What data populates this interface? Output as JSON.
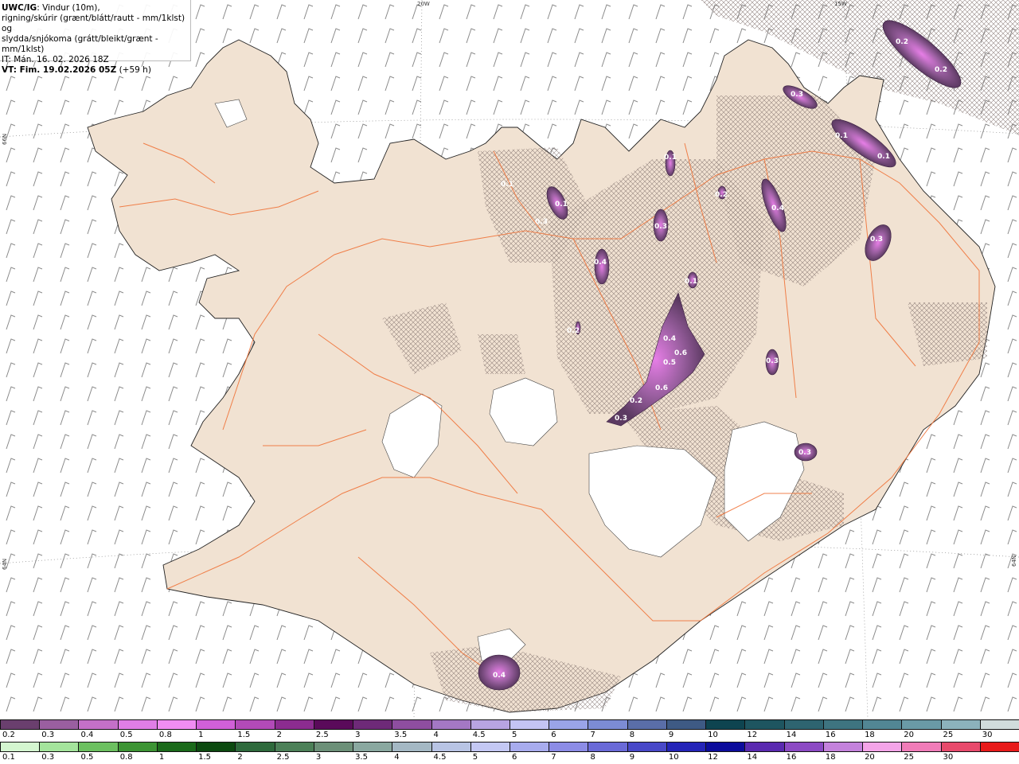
{
  "title": {
    "bold_prefix": "UWC/IG",
    "line1_rest": ": Vindur (10m),",
    "line2": "rigning/skúrir (grænt/blátt/rautt - mm/1klst) og",
    "line3": "slydda/snjókoma (grátt/bleikt/grænt - mm/1klst)",
    "line4": "IT: Mán. 16. 02. 2026 18Z",
    "line5_bold": "VT: Fim. 19.02.2026 05Z",
    "line5_rest": " (+59 h)"
  },
  "coords": {
    "lon_20w": "20W",
    "lon_15w": "15W",
    "lat_66n_left": "66N",
    "lat_64n_left": "64N",
    "lat_64n_right": "64N"
  },
  "contour_labels": [
    "0.2",
    "0.2",
    "0.3",
    "0.1",
    "0.1",
    "0.1",
    "0.1",
    "0.3",
    "0.1",
    "0.3",
    "0.2",
    "0.4",
    "0.3",
    "0.1",
    "0.4",
    "0.2",
    "0.4",
    "0.6",
    "0.5",
    "0.6",
    "0.2",
    "0.3",
    "0.3",
    "0.3",
    "0.4"
  ],
  "legend_snow": {
    "labels": [
      "0.2",
      "0.3",
      "0.4",
      "0.5",
      "0.8",
      "1",
      "1.5",
      "2",
      "2.5",
      "3",
      "3.5",
      "4",
      "4.5",
      "5",
      "6",
      "7",
      "8",
      "9",
      "10",
      "12",
      "14",
      "16",
      "18",
      "20",
      "25",
      "30"
    ],
    "colors": [
      "#6a3f6e",
      "#9a5fa0",
      "#c470c8",
      "#e07ee6",
      "#f08df2",
      "#d060d8",
      "#b24ab8",
      "#8c2c90",
      "#5a0a5a",
      "#6e2a78",
      "#8e4ea0",
      "#a478c4",
      "#b8a4e2",
      "#c4c4f4",
      "#9aa4e8",
      "#7c8cd4",
      "#5a6ea8",
      "#3e5a84",
      "#0e4450",
      "#1e5560",
      "#2e6470",
      "#3e7480",
      "#528694",
      "#6a9aa6",
      "#8cb2bc",
      "#d0dcdc"
    ]
  },
  "legend_rain": {
    "labels": [
      "0.1",
      "0.3",
      "0.5",
      "0.8",
      "1",
      "1.5",
      "2",
      "2.5",
      "3",
      "3.5",
      "4",
      "4.5",
      "5",
      "6",
      "7",
      "8",
      "9",
      "10",
      "12",
      "14",
      "16",
      "18",
      "20",
      "25",
      "30"
    ],
    "colors": [
      "#d4f6d0",
      "#a4e49c",
      "#6cc060",
      "#3c9434",
      "#1a6a1a",
      "#0c4a10",
      "#2e6a3c",
      "#4c8058",
      "#6c9078",
      "#8aa8a0",
      "#a4b8c4",
      "#b8c4e4",
      "#c4c8f4",
      "#a8acee",
      "#8c8ce6",
      "#6a6ad8",
      "#4848c8",
      "#2424b8",
      "#0c0c9c",
      "#5a2ab0",
      "#8c4ac4",
      "#c482dc",
      "#f4a4e8",
      "#f07cb8",
      "#e84a6c",
      "#e81a1a"
    ]
  }
}
